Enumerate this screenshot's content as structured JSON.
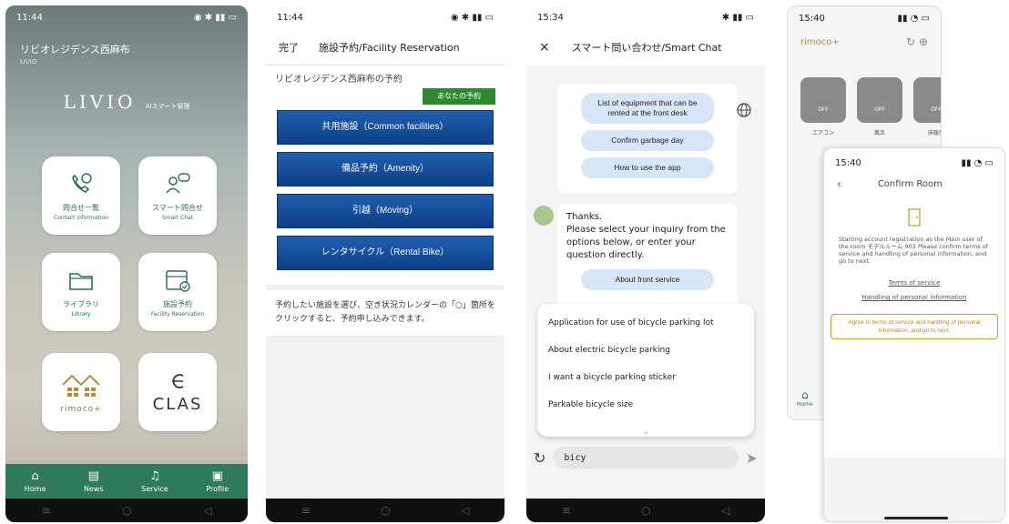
{
  "p1": {
    "time": "11:44",
    "title": "リビオレジデンス西麻布",
    "subtitle": "LIVIO",
    "logo": "LIVIO",
    "logo_sub": "AIスマート管理",
    "tiles": [
      {
        "t1": "問合せ一覧",
        "t2": "Contact information"
      },
      {
        "t1": "スマート問合せ",
        "t2": "Smart Chat"
      },
      {
        "t1": "ライブラリ",
        "t2": "Library"
      },
      {
        "t1": "施設予約",
        "t2": "Facility Reservation"
      },
      {
        "t1": "rimoco+",
        "t2": ""
      },
      {
        "t1": "CLAS",
        "t2": ""
      }
    ],
    "nav": [
      "Home",
      "News",
      "Service",
      "Profile"
    ]
  },
  "p2": {
    "time": "11:44",
    "done": "完了",
    "title": "施設予約/Facility Reservation",
    "name": "リビオレジデンス西麻布の予約",
    "my_booking": "あなたの予約",
    "buttons": [
      "共用施設（Common facilities）",
      "備品予約（Amenity）",
      "引越（Moving）",
      "レンタサイクル（Rental Bike）"
    ],
    "note": "予約したい施設を選び、空き状況カレンダーの「○」箇所をクリックすると、予約申し込みできます。"
  },
  "p3": {
    "time": "15:34",
    "close": "×",
    "title": "スマート問い合わせ/Smart Chat",
    "pills_top": [
      "List of equipment that can be rented at the front desk",
      "Confirm garbage day",
      "How to use the app"
    ],
    "bot_text": "Thanks.\nPlease select your inquiry from the options below, or enter your question directly.",
    "pill_front": "About front service",
    "suggestions": [
      "Application for use of bicycle parking lot",
      "About electric bicycle parking",
      "I want a bicycle parking sticker",
      "Parkable bicycle size"
    ],
    "input_value": "bicy"
  },
  "p4": {
    "time": "15:40",
    "brand": "rimoco+",
    "devices": [
      {
        "state": "OFF",
        "label": "エアコン"
      },
      {
        "state": "OFF",
        "label": "風呂"
      },
      {
        "state": "OFF",
        "label": "床暖房"
      }
    ],
    "home": "Home"
  },
  "p5": {
    "time": "15:40",
    "title": "Confirm Room",
    "text": "Starting account registration as the Main user of the room モデルルーム 903 Please confirm terms of service and handling of personal information, and go to next.",
    "terms": "Terms of service",
    "privacy": "Handling of personal information",
    "agree": "Agree to terms of service and handling of personal information, and go to next."
  }
}
